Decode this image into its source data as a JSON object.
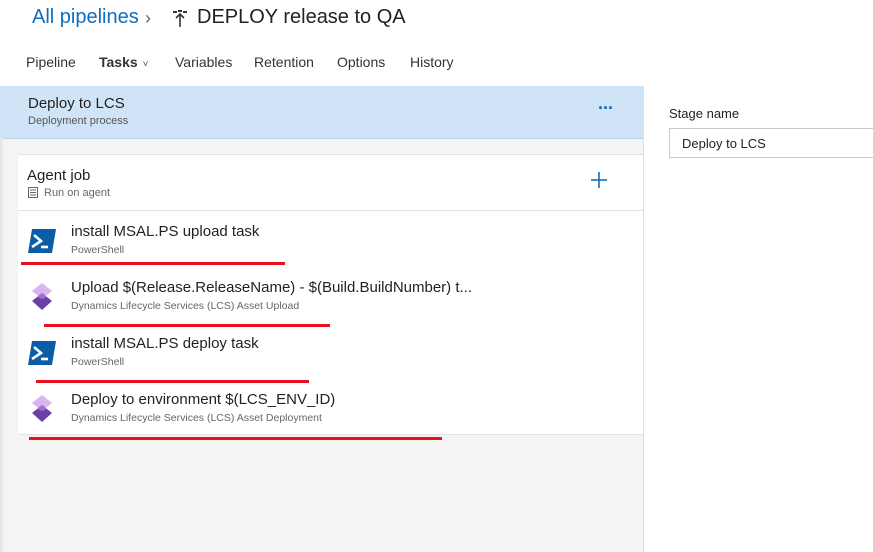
{
  "header": {
    "breadcrumb": "All pipelines",
    "chevron": "›",
    "title": "DEPLOY release to QA"
  },
  "tabs": [
    {
      "label": "Pipeline",
      "active": false
    },
    {
      "label": "Tasks",
      "active": true,
      "caret": "˅"
    },
    {
      "label": "Variables",
      "active": false
    },
    {
      "label": "Retention",
      "active": false
    },
    {
      "label": "Options",
      "active": false
    },
    {
      "label": "History",
      "active": false
    }
  ],
  "stage": {
    "name": "Deploy to LCS",
    "subtitle": "Deployment process",
    "more": "···"
  },
  "agent_job": {
    "title": "Agent job",
    "subtitle": "Run on agent",
    "add": "+"
  },
  "tasks": [
    {
      "title": "install MSAL.PS upload task",
      "subtitle": "PowerShell",
      "icon": "powershell-icon"
    },
    {
      "title": "Upload $(Release.ReleaseName) - $(Build.BuildNumber) t...",
      "subtitle": "Dynamics Lifecycle Services (LCS) Asset Upload",
      "icon": "lcs-icon"
    },
    {
      "title": "install MSAL.PS deploy task",
      "subtitle": "PowerShell",
      "icon": "powershell-icon"
    },
    {
      "title": "Deploy to environment $(LCS_ENV_ID)",
      "subtitle": "Dynamics Lifecycle Services (LCS) Asset Deployment",
      "icon": "lcs-icon"
    }
  ],
  "properties": {
    "stage_name_label": "Stage name",
    "stage_name_value": "Deploy to LCS"
  },
  "colors": {
    "link": "#106ebe",
    "stage_bg": "#cfe4f6",
    "annotation_red": "#e8101f",
    "powershell_blue": "#0b5da8",
    "lcs_purple": "#7b4fb0"
  }
}
